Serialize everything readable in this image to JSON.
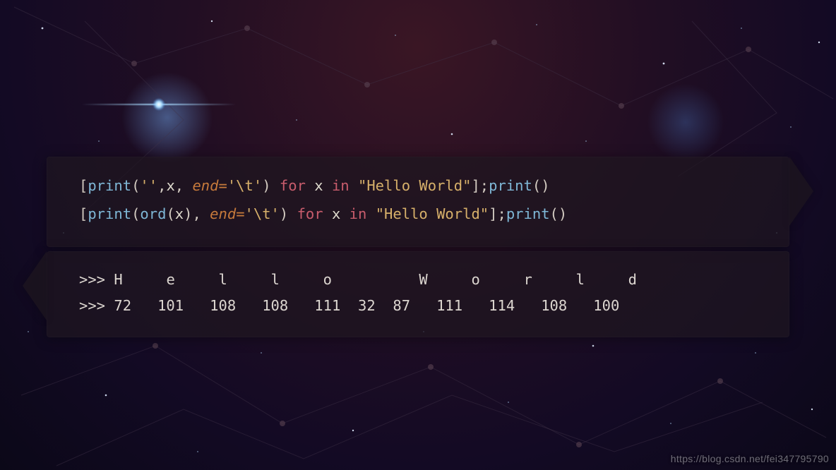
{
  "code": {
    "line1": {
      "open": "[",
      "fn1": "print",
      "paren_open": "(",
      "arg1": "''",
      "comma1": ",",
      "arg2": "x",
      "comma2": ",",
      "space_kw": " ",
      "kwarg": "end",
      "eq": "=",
      "kwarg_val": "'\\t'",
      "paren_close": ")",
      "space1": " ",
      "for": "for",
      "space2": " ",
      "loopvar": "x",
      "space3": " ",
      "in": "in",
      "space4": " ",
      "iter": "\"Hello World\"",
      "close": "]",
      "semi": ";",
      "fn2": "print",
      "paren2": "()"
    },
    "line2": {
      "open": "[",
      "fn1": "print",
      "paren_open": "(",
      "fn_inner": "ord",
      "paren_inner_open": "(",
      "arg_inner": "x",
      "paren_inner_close": ")",
      "comma2": ",",
      "space_kw": " ",
      "kwarg": "end",
      "eq": "=",
      "kwarg_val": "'\\t'",
      "paren_close": ")",
      "space1": " ",
      "for": "for",
      "space2": " ",
      "loopvar": "x",
      "space3": " ",
      "in": "in",
      "space4": " ",
      "iter": "\"Hello World\"",
      "close": "]",
      "semi": ";",
      "fn2": "print",
      "paren2": "()"
    }
  },
  "output": {
    "prompt": ">>>",
    "chars": [
      "H",
      "e",
      "l",
      "l",
      "o",
      "",
      "W",
      "o",
      "r",
      "l",
      "d"
    ],
    "codes": [
      "72",
      "101",
      "108",
      "108",
      "111",
      "32",
      "87",
      "111",
      "114",
      "108",
      "100"
    ]
  },
  "watermark": "https://blog.csdn.net/fei347795790"
}
